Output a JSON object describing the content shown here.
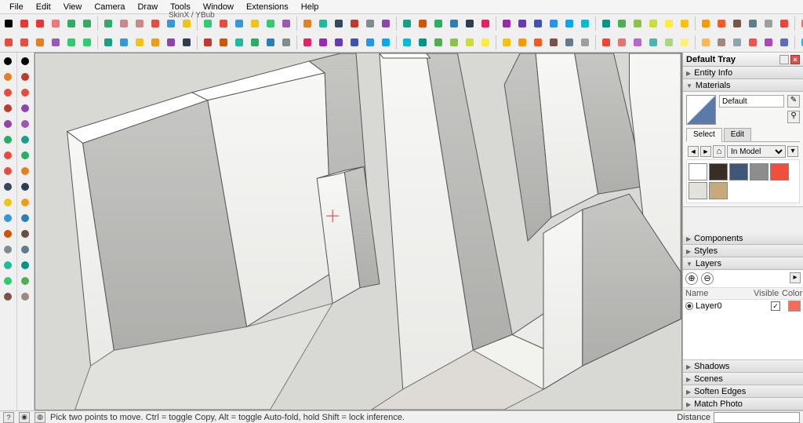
{
  "menus": [
    "File",
    "Edit",
    "View",
    "Camera",
    "Draw",
    "Tools",
    "Window",
    "Extensions",
    "Help"
  ],
  "ribbon_label": "SkinX / YBub",
  "tray": {
    "title": "Default Tray",
    "sections": {
      "entity_info": "Entity Info",
      "materials": "Materials",
      "components": "Components",
      "styles": "Styles",
      "layers": "Layers",
      "shadows": "Shadows",
      "scenes": "Scenes",
      "soften_edges": "Soften Edges",
      "match_photo": "Match Photo"
    },
    "materials": {
      "current_name": "Default",
      "tab_select": "Select",
      "tab_edit": "Edit",
      "library": "In Model",
      "swatches": [
        "#ffffff",
        "#3a2d23",
        "#3f5877",
        "#8d8d8d",
        "#f04f3b",
        "#e3e1dc",
        "#c7a97a"
      ]
    },
    "layers": {
      "head_name": "Name",
      "head_visible": "Visible",
      "head_color": "Color",
      "rows": [
        {
          "name": "Layer0",
          "visible": true,
          "color": "#f66b5c"
        }
      ]
    }
  },
  "status": {
    "hint": "Pick two points to move. Ctrl = toggle Copy, Alt = toggle Auto-fold, hold Shift = lock inference.",
    "measure_label": "Distance"
  },
  "toolbar": {
    "row1_colors": [
      "#000",
      "#e33",
      "#e33",
      "#e77",
      "#3a6",
      "#3a6",
      "#3a6",
      "#c88",
      "#c88",
      "#e74c3c",
      "#3498db",
      "#f1c40f",
      "#2ecc71",
      "#e74c3c",
      "#3498db",
      "#f1c40f",
      "#2ecc71",
      "#9b59b6",
      "#e67e22",
      "#1abc9c",
      "#34495e",
      "#c0392b",
      "#7f8c8d",
      "#8e44ad",
      "#16a085",
      "#d35400",
      "#27ae60",
      "#2980b9",
      "#2c3e50",
      "#e91e63",
      "#9c27b0",
      "#673ab7",
      "#3f51b5",
      "#2196f3",
      "#03a9f4",
      "#00bcd4",
      "#009688",
      "#4caf50",
      "#8bc34a",
      "#cddc39",
      "#ffeb3b",
      "#ffc107",
      "#ff9800",
      "#ff5722",
      "#795548",
      "#607d8b",
      "#9e9e9e",
      "#f44336",
      "#e57373"
    ],
    "row1_names": [
      "select-icon",
      "eraser-icon",
      "line-icon",
      "freehand-icon",
      "rect-icon",
      "circle-icon",
      "polygon-icon",
      "arc-icon",
      "pushpull-icon",
      "move-icon",
      "rotate-icon",
      "scale-icon",
      "offset-icon",
      "tape-icon",
      "protractor-icon",
      "text-icon",
      "axes-icon",
      "dimension-icon",
      "section-icon",
      "orbit-icon",
      "pan-icon",
      "zoom-icon",
      "zoom-extents-icon",
      "zoom-window-icon",
      "prev-view-icon",
      "next-view-icon",
      "position-cam-icon",
      "look-around-icon",
      "walk-icon",
      "iso-icon",
      "top-icon",
      "front-icon",
      "right-icon",
      "back-icon",
      "left-icon",
      "shadows-icon",
      "fog-icon",
      "xray-icon",
      "backface-icon",
      "wireframe-icon",
      "hidden-line-icon",
      "shaded-icon",
      "shaded-tex-icon",
      "mono-icon",
      "style-icon",
      "style2-icon",
      "style3-icon",
      "style4-icon",
      "style5-icon"
    ],
    "row2_colors": [
      "#e74c3c",
      "#e74c3c",
      "#e67e22",
      "#9b59b6",
      "#2ecc71",
      "#2ecc71",
      "#16a085",
      "#3498db",
      "#f1c40f",
      "#f39c12",
      "#8e44ad",
      "#2c3e50",
      "#c0392b",
      "#d35400",
      "#1abc9c",
      "#27ae60",
      "#2980b9",
      "#7f8c8d",
      "#e91e63",
      "#9c27b0",
      "#673ab7",
      "#3f51b5",
      "#2196f3",
      "#03a9f4",
      "#00bcd4",
      "#009688",
      "#4caf50",
      "#8bc34a",
      "#cddc39",
      "#ffeb3b",
      "#ffc107",
      "#ff9800",
      "#ff5722",
      "#795548",
      "#607d8b",
      "#9e9e9e",
      "#f44336",
      "#e57373",
      "#ba68c8",
      "#4db6ac",
      "#aed581",
      "#fff176",
      "#ffb74d",
      "#a1887f",
      "#90a4ae",
      "#ef5350",
      "#ab47bc",
      "#5c6bc0",
      "#29b6f6",
      "#26a69a"
    ],
    "row2_names": [
      "ext-a-icon",
      "ext-b-icon",
      "ext-c-icon",
      "ext-d-icon",
      "ext-e-icon",
      "ext-f-icon",
      "ext-g-icon",
      "ext-h-icon",
      "ext-i-icon",
      "ext-j-icon",
      "ext-k-icon",
      "ext-l-icon",
      "ext-m-icon",
      "ext-n-icon",
      "ext-o-icon",
      "ext-p-icon",
      "ext-q-icon",
      "ext-r-icon",
      "ext-s-icon",
      "ext-t-icon",
      "ext-u-icon",
      "ext-v-icon",
      "ext-w-icon",
      "ext-x-icon",
      "ext-y-icon",
      "ext-z-icon",
      "ext-aa-icon",
      "ext-ab-icon",
      "ext-ac-icon",
      "ext-ad-icon",
      "ext-ae-icon",
      "ext-af-icon",
      "ext-ag-icon",
      "ext-ah-icon",
      "ext-ai-icon",
      "ext-aj-icon",
      "ext-ak-icon",
      "ext-al-icon",
      "ext-am-icon",
      "ext-an-icon",
      "ext-ao-icon",
      "ext-ap-icon",
      "ext-aq-icon",
      "ext-ar-icon",
      "ext-as-icon",
      "ext-at-icon",
      "ext-au-icon",
      "ext-av-icon",
      "ext-aw-icon",
      "ext-ax-icon"
    ],
    "left_col1": [
      "select-icon",
      "paintbucket-icon",
      "lines-icon",
      "arcs-icon",
      "shapes-icon",
      "pushpull-icon",
      "move-icon",
      "rotate-icon",
      "text-icon",
      "tape-icon",
      "walk-icon",
      "3dwh-icon",
      "section-icon",
      "face-icon",
      "sandbox-icon",
      "footprint-icon"
    ],
    "left_col2": [
      "make-comp-icon",
      "eraser-icon",
      "freehand-icon",
      "2pt-arc-icon",
      "polygon-icon",
      "followme-icon",
      "offset-icon",
      "scale-icon",
      "dims-icon",
      "protractor-icon",
      "look-icon",
      "ext-wh-icon",
      "solid-icon",
      "style-icon",
      "geo-icon",
      "review-icon"
    ],
    "left_colors1": [
      "#000",
      "#e67e22",
      "#e74c3c",
      "#c0392b",
      "#8e44ad",
      "#27ae60",
      "#e74c3c",
      "#e74c3c",
      "#34495e",
      "#f1c40f",
      "#3498db",
      "#d35400",
      "#7f8c8d",
      "#1abc9c",
      "#2ecc71",
      "#795548"
    ],
    "left_colors2": [
      "#000",
      "#c0392b",
      "#e74c3c",
      "#8e44ad",
      "#9b59b6",
      "#16a085",
      "#27ae60",
      "#e67e22",
      "#2c3e50",
      "#f39c12",
      "#2980b9",
      "#6d4c41",
      "#607d8b",
      "#009688",
      "#4caf50",
      "#a1887f"
    ]
  }
}
